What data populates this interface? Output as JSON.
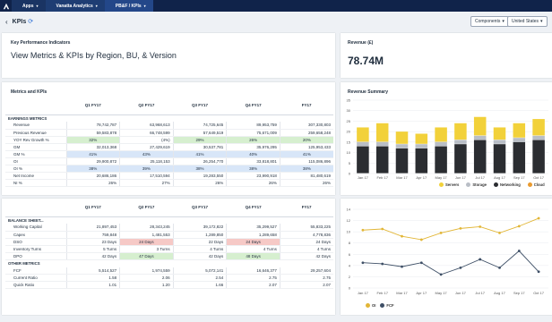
{
  "nav": {
    "crumbs": [
      {
        "label": "Apps"
      },
      {
        "label": "Vanatta Analytics"
      },
      {
        "label": "PB&F / KPIs"
      }
    ]
  },
  "page": {
    "title": "KPIs",
    "components_label": "Components",
    "region_label": "United States"
  },
  "kpi_card": {
    "title": "Key Performance Indicators",
    "subtitle": "View Metrics & KPIs by Region, BU, & Version"
  },
  "revenue_card": {
    "title": "Revenue (£)",
    "value": "78.74M"
  },
  "metrics": {
    "title": "Metrics and KPIs",
    "columns": [
      "Q1 FY17",
      "Q2 FY17",
      "Q3 FY17",
      "Q4 FY17",
      "FY17"
    ],
    "rows": [
      {
        "type": "section",
        "label": "EARNINGS METRICS"
      },
      {
        "type": "row",
        "label": "Revenue",
        "values": [
          "78,742,787",
          "63,968,613",
          "74,725,645",
          "89,953,759",
          "307,330,803"
        ]
      },
      {
        "type": "row",
        "label": "Previous Revenue",
        "values": [
          "59,583,878",
          "66,748,599",
          "57,649,519",
          "75,671,009",
          "259,658,248"
        ]
      },
      {
        "type": "row",
        "label": "YOY Rev Growth %",
        "values": [
          "32%",
          "(4%)",
          "29%",
          "26%",
          "20%"
        ],
        "styles": [
          "good",
          "",
          "good",
          "good",
          "good"
        ]
      },
      {
        "type": "row",
        "label": "GM",
        "values": [
          "32,013,368",
          "27,429,619",
          "30,537,781",
          "35,976,295",
          "125,953,433"
        ]
      },
      {
        "type": "row",
        "label": "GM %",
        "values": [
          "41%",
          "43%",
          "41%",
          "40%",
          "41%"
        ],
        "styles": [
          "blue",
          "blue",
          "blue",
          "blue",
          "blue"
        ]
      },
      {
        "type": "row",
        "label": "OI",
        "values": [
          "29,900,872",
          "25,118,153",
          "26,254,770",
          "33,818,801",
          "115,086,896"
        ]
      },
      {
        "type": "row",
        "label": "OI %",
        "values": [
          "38%",
          "39%",
          "38%",
          "38%",
          "38%"
        ],
        "styles": [
          "blue",
          "blue",
          "blue",
          "blue",
          "blue"
        ]
      },
      {
        "type": "row",
        "label": "Net Income",
        "values": [
          "20,686,186",
          "17,510,594",
          "19,283,550",
          "23,990,918",
          "81,480,619"
        ]
      },
      {
        "type": "row",
        "label": "NI %",
        "values": [
          "26%",
          "27%",
          "26%",
          "26%",
          "26%"
        ]
      }
    ]
  },
  "balance": {
    "columns": [
      "Q1 FY17",
      "Q2 FY17",
      "Q3 FY17",
      "Q4 FY17",
      "FY17"
    ],
    "rows": [
      {
        "type": "section",
        "label": "BALANCE SHEET..."
      },
      {
        "type": "row",
        "label": "Working Capital",
        "values": [
          "21,897,453",
          "28,343,245",
          "39,172,822",
          "35,299,527",
          "55,833,225"
        ]
      },
      {
        "type": "row",
        "label": "Capex",
        "values": [
          "759,848",
          "1,481,553",
          "1,289,850",
          "1,289,658",
          "4,778,836"
        ]
      },
      {
        "type": "row",
        "label": "DSO",
        "values": [
          "23 Days",
          "24 Days",
          "22 Days",
          "24 Days",
          "24 Days"
        ],
        "styles": [
          "",
          "bad",
          "",
          "bad",
          ""
        ]
      },
      {
        "type": "row",
        "label": "Inventory Turns",
        "values": [
          "5 Turns",
          "3 Turns",
          "4 Turns",
          "4 Turns",
          "4 Turns"
        ]
      },
      {
        "type": "row",
        "label": "DPO",
        "values": [
          "42 Days",
          "47 Days",
          "42 Days",
          "48 Days",
          "42 Days"
        ],
        "styles": [
          "",
          "good",
          "",
          "good",
          ""
        ]
      },
      {
        "type": "section",
        "label": "OTHER METRICS"
      },
      {
        "type": "row",
        "label": "FCF",
        "values": [
          "5,514,527",
          "1,974,559",
          "5,072,141",
          "16,646,377",
          "29,257,604"
        ]
      },
      {
        "type": "row",
        "label": "Current Ratio",
        "values": [
          "1.58",
          "2.06",
          "2.54",
          "2.75",
          "2.75"
        ]
      },
      {
        "type": "row",
        "label": "Quick Ratio",
        "values": [
          "1.01",
          "1.20",
          "1.66",
          "2.07",
          "2.07"
        ]
      }
    ]
  },
  "revenue_summary": {
    "title": "Revenue Summary"
  },
  "chart_data": [
    {
      "type": "bar",
      "stacked": true,
      "title": "Revenue Summary",
      "categories": [
        "Jan 17",
        "Feb 17",
        "Mar 17",
        "Apr 17",
        "May 17",
        "Jun 17",
        "Jul 17",
        "Aug 17",
        "Sep 17",
        "Oct 17"
      ],
      "ylim": [
        0,
        35
      ],
      "y_ticks": [
        "0",
        "5",
        "10",
        "15",
        "20",
        "25",
        "30",
        "35"
      ],
      "series": [
        {
          "name": "Servers",
          "color": "#f2d13a",
          "values": [
            7,
            9,
            6,
            5,
            7,
            8,
            9,
            6,
            7,
            8
          ]
        },
        {
          "name": "Storage",
          "color": "#b9bec6",
          "values": [
            2,
            2,
            2,
            2,
            2,
            2,
            2,
            2,
            2,
            2
          ]
        },
        {
          "name": "Networking",
          "color": "#2b2d31",
          "values": [
            13,
            13,
            12,
            12,
            13,
            14,
            16,
            14,
            15,
            16
          ]
        },
        {
          "name": "Cloud",
          "color": "#e99a2f",
          "values": [
            0,
            0,
            0,
            0,
            0,
            0,
            0,
            0,
            0,
            0
          ]
        }
      ],
      "legend": "bottom"
    },
    {
      "type": "line",
      "categories": [
        "Jan 17",
        "Feb 17",
        "Mar 17",
        "Apr 17",
        "May 17",
        "Jun 17",
        "Jul 17",
        "Aug 17",
        "Sep 17",
        "Oct 17"
      ],
      "ylim": [
        0,
        14
      ],
      "y_ticks": [
        "0",
        "2",
        "4",
        "6",
        "8",
        "10",
        "12",
        "14"
      ],
      "series": [
        {
          "name": "OI",
          "color": "#e2b636",
          "values": [
            10.3,
            10.5,
            9.2,
            8.6,
            9.8,
            10.6,
            10.9,
            9.8,
            11.0,
            12.4
          ]
        },
        {
          "name": "FCF",
          "color": "#3e4f66",
          "values": [
            4.5,
            4.3,
            3.8,
            4.5,
            2.4,
            3.6,
            5.1,
            3.6,
            6.6,
            2.9
          ]
        }
      ],
      "legend": "bottom"
    }
  ]
}
